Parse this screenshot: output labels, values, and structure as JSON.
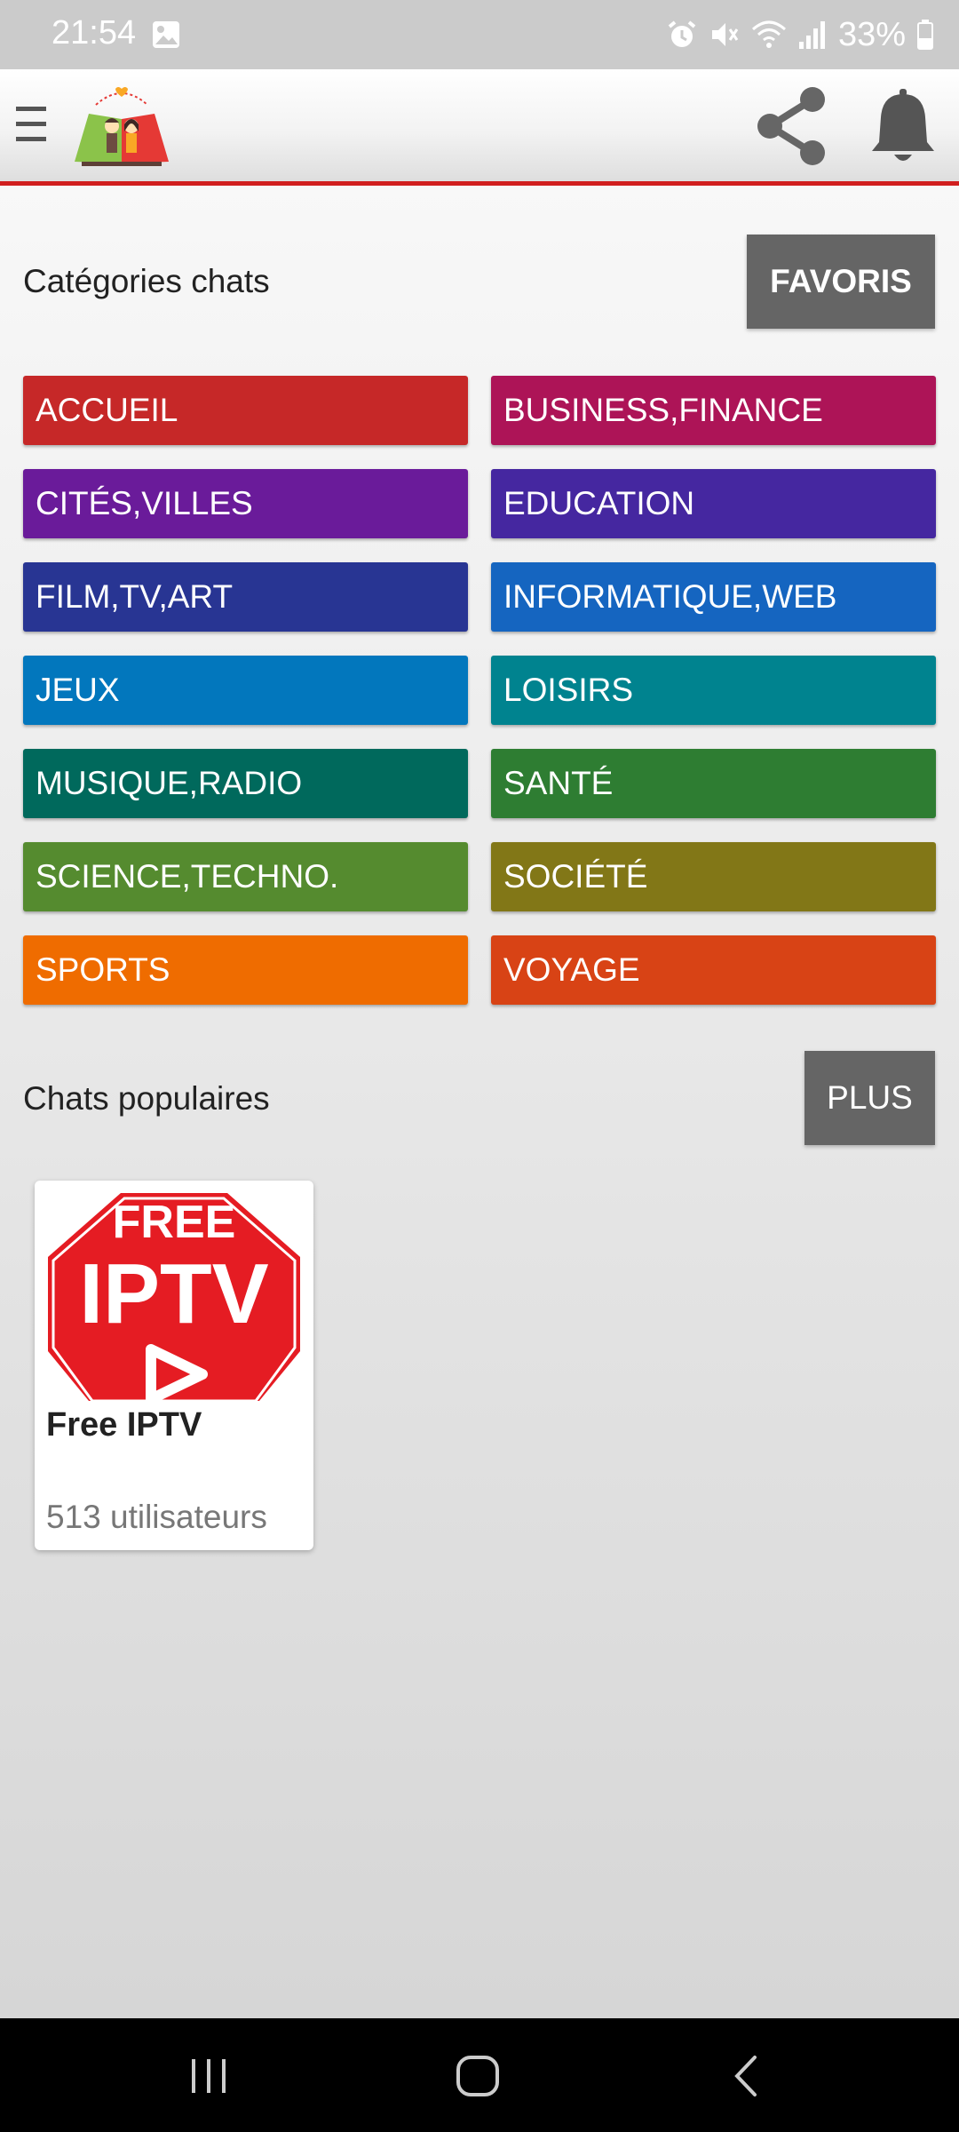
{
  "status_bar": {
    "time": "21:54",
    "battery": "33%"
  },
  "header": {
    "menu_icon": "hamburger-menu-icon",
    "logo_icon": "app-logo-couple",
    "share_icon": "share-icon",
    "notifications_icon": "bell-icon",
    "accent_color": "#d11e1e"
  },
  "categories_section": {
    "title": "Catégories chats",
    "favorites_label": "FAVORIS",
    "items": [
      {
        "label": "ACCUEIL",
        "color": "#c62828"
      },
      {
        "label": "BUSINESS,FINANCE",
        "color": "#ad1457"
      },
      {
        "label": "CITÉS,VILLES",
        "color": "#6a1b9a"
      },
      {
        "label": "EDUCATION",
        "color": "#4527a0"
      },
      {
        "label": "FILM,TV,ART",
        "color": "#283593"
      },
      {
        "label": "INFORMATIQUE,WEB",
        "color": "#1565c0"
      },
      {
        "label": "JEUX",
        "color": "#0277bd"
      },
      {
        "label": "LOISIRS",
        "color": "#00838f"
      },
      {
        "label": "MUSIQUE,RADIO",
        "color": "#00695c"
      },
      {
        "label": "SANTÉ",
        "color": "#2e7d32"
      },
      {
        "label": "SCIENCE,TECHNO.",
        "color": "#558b2f"
      },
      {
        "label": "SOCIÉTÉ",
        "color": "#827717"
      },
      {
        "label": "SPORTS",
        "color": "#ef6c00"
      },
      {
        "label": "VOYAGE",
        "color": "#d84315"
      }
    ]
  },
  "popular_section": {
    "title": "Chats populaires",
    "more_label": "PLUS",
    "chats": [
      {
        "name": "Free IPTV",
        "users": "513 utilisateurs",
        "thumb_top": "FREE",
        "thumb_main": "IPTV"
      }
    ]
  }
}
